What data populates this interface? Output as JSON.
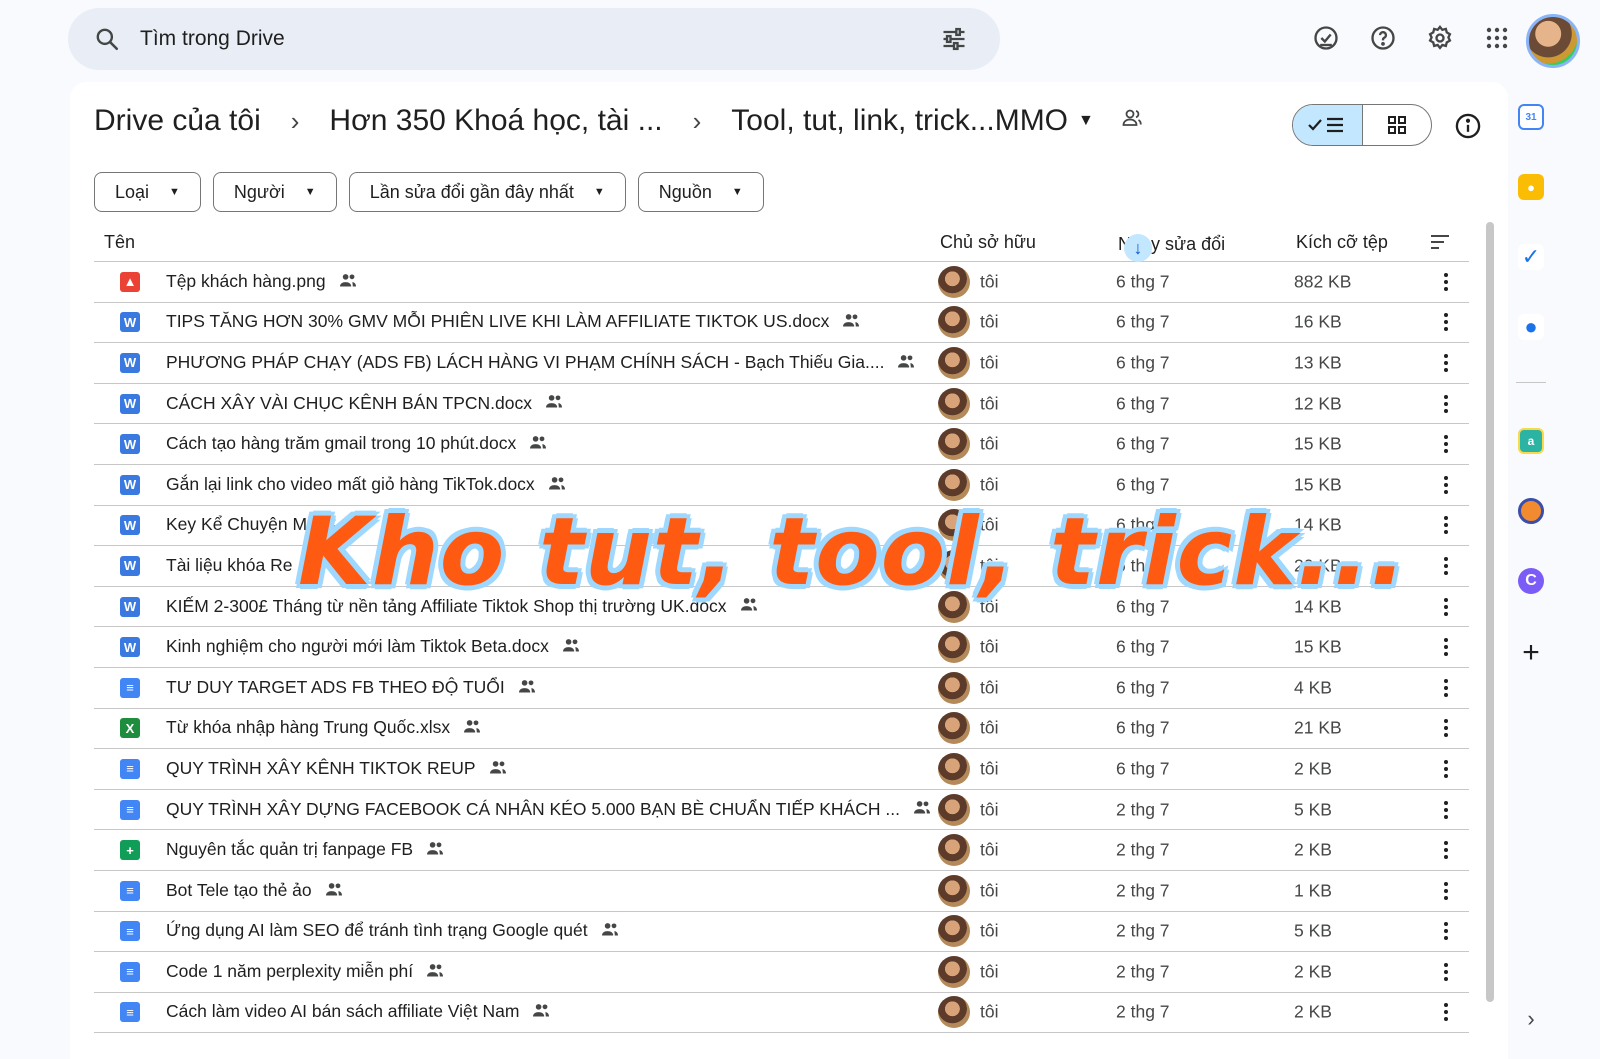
{
  "search": {
    "placeholder": "Tìm trong Drive"
  },
  "breadcrumb": {
    "root": "Drive của tôi",
    "middle": "Hơn 350 Khoá học, tài ...",
    "current": "Tool, tut, link, trick...MMO"
  },
  "filters": [
    "Loại",
    "Người",
    "Lần sửa đổi gần đây nhất",
    "Nguồn"
  ],
  "columns": {
    "name": "Tên",
    "owner": "Chủ sở hữu",
    "modified": "Ngày sửa đổi",
    "size": "Kích cỡ tệp"
  },
  "files": [
    {
      "type": "image",
      "name": "Tệp khách hàng.png",
      "owner": "tôi",
      "date": "6 thg 7",
      "size": "882 KB"
    },
    {
      "type": "word",
      "name": "TIPS TĂNG HƠN 30% GMV MỖI PHIÊN LIVE KHI LÀM AFFILIATE TIKTOK US.docx",
      "owner": "tôi",
      "date": "6 thg 7",
      "size": "16 KB"
    },
    {
      "type": "word",
      "name": "PHƯƠNG PHÁP CHẠY (ADS FB) LÁCH HÀNG VI PHẠM CHÍNH SÁCH - Bạch Thiếu Gia....",
      "owner": "tôi",
      "date": "6 thg 7",
      "size": "13 KB"
    },
    {
      "type": "word",
      "name": "CÁCH XÂY VÀI CHỤC KÊNH BÁN TPCN.docx",
      "owner": "tôi",
      "date": "6 thg 7",
      "size": "12 KB"
    },
    {
      "type": "word",
      "name": "Cách tạo hàng trăm gmail trong 10 phút.docx",
      "owner": "tôi",
      "date": "6 thg 7",
      "size": "15 KB"
    },
    {
      "type": "word",
      "name": "Gắn lại link cho video mất giỏ hàng TikTok.docx",
      "owner": "tôi",
      "date": "6 thg 7",
      "size": "15 KB"
    },
    {
      "type": "word",
      "name": "Key Kể Chuyện M",
      "owner": "tôi",
      "date": "6 thg 7",
      "size": "14 KB"
    },
    {
      "type": "word",
      "name": "Tài liệu khóa Re",
      "owner": "tôi",
      "date": "6 thg 7",
      "size": "20 KB"
    },
    {
      "type": "word",
      "name": "KIẾM 2-300£ Tháng từ nền tảng Affiliate Tiktok Shop thị trường UK.docx",
      "owner": "tôi",
      "date": "6 thg 7",
      "size": "14 KB"
    },
    {
      "type": "word",
      "name": "Kinh nghiệm cho người mới làm Tiktok Beta.docx",
      "owner": "tôi",
      "date": "6 thg 7",
      "size": "15 KB"
    },
    {
      "type": "doc",
      "name": "TƯ DUY TARGET ADS FB THEO ĐỘ TUỔI",
      "owner": "tôi",
      "date": "6 thg 7",
      "size": "4 KB"
    },
    {
      "type": "xls",
      "name": "Từ khóa nhập hàng Trung Quốc.xlsx",
      "owner": "tôi",
      "date": "6 thg 7",
      "size": "21 KB"
    },
    {
      "type": "doc",
      "name": "QUY TRÌNH XÂY KÊNH TIKTOK REUP",
      "owner": "tôi",
      "date": "6 thg 7",
      "size": "2 KB"
    },
    {
      "type": "doc",
      "name": "QUY TRÌNH XÂY DỰNG FACEBOOK CÁ NHÂN KÉO 5.000 BẠN BÈ CHUẨN TIẾP KHÁCH ...",
      "owner": "tôi",
      "date": "2 thg 7",
      "size": "5 KB"
    },
    {
      "type": "sheet",
      "name": "Nguyên tắc quản trị fanpage FB",
      "owner": "tôi",
      "date": "2 thg 7",
      "size": "2 KB"
    },
    {
      "type": "doc",
      "name": "Bot Tele tạo thẻ ảo",
      "owner": "tôi",
      "date": "2 thg 7",
      "size": "1 KB"
    },
    {
      "type": "doc",
      "name": "Ứng dụng AI làm SEO để tránh tình trạng Google quét",
      "owner": "tôi",
      "date": "2 thg 7",
      "size": "5 KB"
    },
    {
      "type": "doc",
      "name": "Code 1 năm perplexity miễn phí",
      "owner": "tôi",
      "date": "2 thg 7",
      "size": "2 KB"
    },
    {
      "type": "doc",
      "name": "Cách làm video AI bán sách affiliate Việt Nam",
      "owner": "tôi",
      "date": "2 thg 7",
      "size": "2 KB"
    }
  ],
  "overlay_text": "Kho tut, tool, trick...",
  "rail": [
    "calendar-app",
    "keep-app",
    "tasks-app",
    "contacts-app",
    "extension-a",
    "extension-b",
    "extension-c",
    "add-app"
  ]
}
